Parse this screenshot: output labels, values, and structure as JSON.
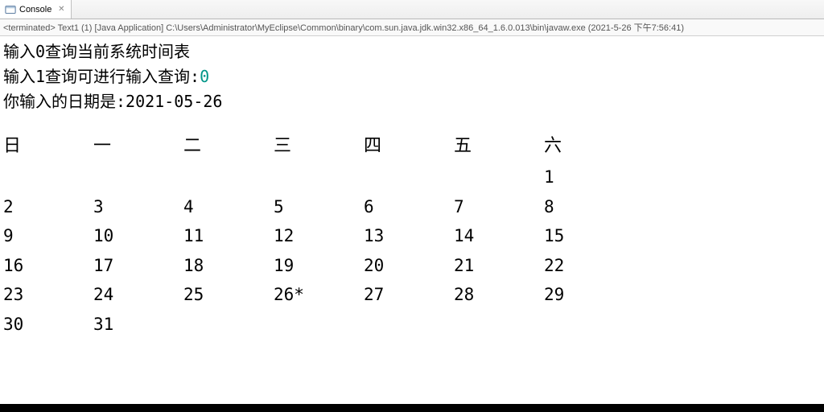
{
  "tab": {
    "title": "Console"
  },
  "status": "<terminated> Text1 (1) [Java Application] C:\\Users\\Administrator\\MyEclipse\\Common\\binary\\com.sun.java.jdk.win32.x86_64_1.6.0.013\\bin\\javaw.exe (2021-5-26 下午7:56:41)",
  "lines": {
    "l1": "输入0查询当前系统时间表",
    "l2_prefix": "输入1查询可进行输入查询:",
    "l2_input": "0",
    "l3_prefix": "你输入的日期是:",
    "l3_date": "2021-05-26"
  },
  "calendar": {
    "headers": [
      "日",
      "一",
      "二",
      "三",
      "四",
      "五",
      "六"
    ],
    "rows": [
      [
        "",
        "",
        "",
        "",
        "",
        "",
        "1"
      ],
      [
        "2",
        "3",
        "4",
        "5",
        "6",
        "7",
        "8"
      ],
      [
        "9",
        "10",
        "11",
        "12",
        "13",
        "14",
        "15"
      ],
      [
        "16",
        "17",
        "18",
        "19",
        "20",
        "21",
        "22"
      ],
      [
        "23",
        "24",
        "25",
        "26*",
        "27",
        "28",
        "29"
      ],
      [
        "30",
        "31",
        "",
        "",
        "",
        "",
        ""
      ]
    ]
  }
}
